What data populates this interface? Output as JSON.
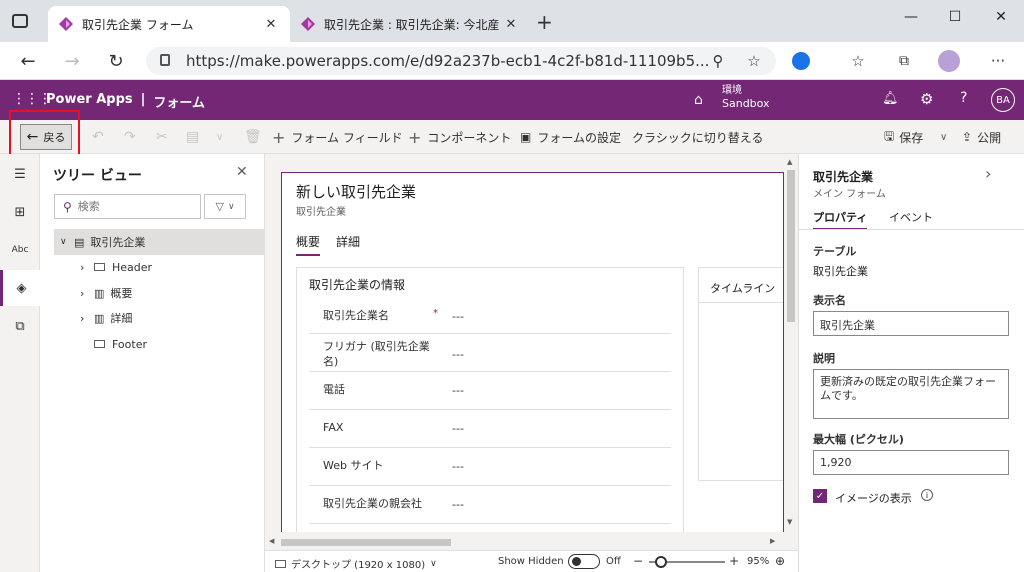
{
  "browser": {
    "tabs": [
      {
        "title": "取引先企業 フォーム"
      },
      {
        "title": "取引先企業 : 取引先企業: 今北産"
      }
    ],
    "new_tab": "+",
    "url": "https://make.powerapps.com/e/d92a237b-ecb1-4c2f-b81d-11109b5..."
  },
  "app": {
    "name": "Power Apps",
    "separator": "|",
    "section": "フォーム",
    "env_label": "環境",
    "env_name": "Sandbox",
    "avatar": "BA"
  },
  "commands": {
    "back": "戻る",
    "form_field": "フォーム フィールド",
    "component": "コンポーネント",
    "form_settings": "フォームの設定",
    "switch_classic": "クラシックに切り替える",
    "save": "保存",
    "publish": "公開"
  },
  "tree": {
    "title": "ツリー ビュー",
    "search_placeholder": "検索",
    "items": [
      {
        "label": "取引先企業"
      },
      {
        "label": "Header"
      },
      {
        "label": "概要"
      },
      {
        "label": "詳細"
      },
      {
        "label": "Footer"
      }
    ]
  },
  "form": {
    "title": "新しい取引先企業",
    "subtitle": "取引先企業",
    "tabs": [
      {
        "label": "概要"
      },
      {
        "label": "詳細"
      }
    ],
    "section_title": "取引先企業の情報",
    "timeline": "タイムライン",
    "required_mark": "*",
    "fields": [
      {
        "label": "取引先企業名",
        "value": "---"
      },
      {
        "label": "フリガナ (取引先企業名)",
        "value": "---"
      },
      {
        "label": "電話",
        "value": "---"
      },
      {
        "label": "FAX",
        "value": "---"
      },
      {
        "label": "Web サイト",
        "value": "---"
      },
      {
        "label": "取引先企業の親会社",
        "value": "---"
      }
    ]
  },
  "statusbar": {
    "device": "デスクトップ (1920 x 1080)",
    "show_hidden": "Show Hidden",
    "toggle_state": "Off",
    "zoom_minus": "−",
    "zoom_plus": "+",
    "zoom": "95%"
  },
  "props": {
    "title": "取引先企業",
    "subtitle": "メイン フォーム",
    "tabs": [
      {
        "label": "プロパティ"
      },
      {
        "label": "イベント"
      }
    ],
    "table_label": "テーブル",
    "table_value": "取引先企業",
    "display_name_label": "表示名",
    "display_name_value": "取引先企業",
    "description_label": "説明",
    "description_value": "更新済みの既定の取引先企業フォームです。",
    "max_width_label": "最大幅 (ピクセル)",
    "max_width_value": "1,920",
    "show_image_label": "イメージの表示",
    "show_image_checked": true
  },
  "colors": {
    "brand": "#742774",
    "highlight": "#e81123"
  }
}
